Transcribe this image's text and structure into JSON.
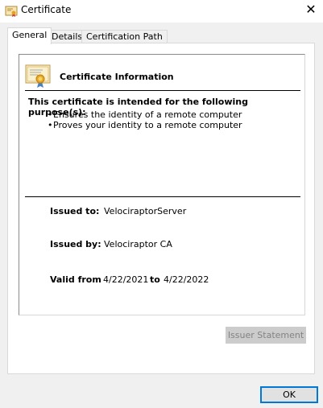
{
  "window": {
    "title": "Certificate",
    "close_glyph": "✕",
    "icon": "certificate-icon"
  },
  "tabs": [
    {
      "label": "General",
      "active": true
    },
    {
      "label": "Details",
      "active": false
    },
    {
      "label": "Certification Path",
      "active": false
    }
  ],
  "cert": {
    "heading": "Certificate Information",
    "purpose_heading": "This certificate is intended for the following purpose(s):",
    "purposes": [
      "Ensures the identity of a remote computer",
      "Proves your identity to a remote computer"
    ],
    "issued_to_label": "Issued to:",
    "issued_to_value": "VelociraptorServer",
    "issued_by_label": "Issued by:",
    "issued_by_value": "Velociraptor CA",
    "valid_from_label": "Valid from",
    "valid_from_value": "4/22/2021",
    "valid_to_label": "to",
    "valid_to_value": "4/22/2022"
  },
  "buttons": {
    "issuer_statement": "Issuer Statement",
    "ok": "OK"
  },
  "colors": {
    "dialog_bg": "#f0f0f0",
    "focus_accent": "#0078d7",
    "disabled_text": "#838383"
  }
}
